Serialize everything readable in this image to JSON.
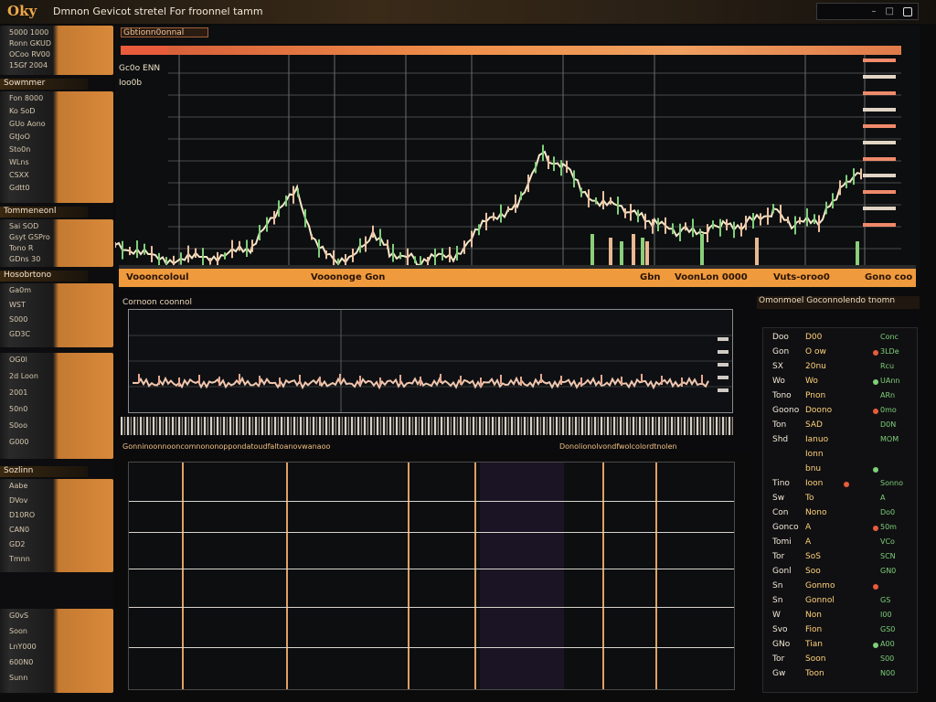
{
  "app": {
    "logo": "Oky",
    "title": "Dmnon Gevicot stretel  For froonnel tamm"
  },
  "window_controls": {
    "minimize": "–",
    "maximize": "□",
    "close": "×"
  },
  "sidebar": {
    "sections": [
      {
        "header": "",
        "rows": [
          "5000  1000",
          "Ronn  GKUD",
          "OCoo  RV00",
          "15Gf  2004"
        ]
      },
      {
        "header": "Sowmmer",
        "rows": [
          "Fon  8000",
          "Ko  SoD",
          "GUo  Aono",
          "GtJoO",
          "Sto0n",
          "WLns",
          "CSXX",
          "Gdtt0"
        ]
      },
      {
        "header": "Tommeneonl",
        "rows": [
          "Sai  SOD",
          "Gsyt  GSPro",
          "Tono  R",
          "GDns  30"
        ]
      },
      {
        "header": "Hosobrtono",
        "rows": [
          "Ga0m",
          "WST",
          "S000",
          "GD3C"
        ]
      },
      {
        "header": "",
        "rows": [
          "OG0l",
          "2d  Loon",
          "2001",
          "50n0",
          "S0oo",
          "G000"
        ]
      },
      {
        "header": "Sozlinn",
        "rows": [
          "Aabe",
          "DVov",
          "D10RO",
          "CAN0",
          "GD2",
          "Tmnn"
        ]
      },
      {
        "header": "",
        "rows": [
          "G0vS",
          "Soon",
          "LnY000",
          "600N0",
          "Sunn"
        ]
      }
    ]
  },
  "main_chart": {
    "top_label": "Gbtionn0onnal",
    "sub1": "Gc0o ENN",
    "sub2": "Ioo0b",
    "axis_labels": [
      "Voooncoloul",
      "Vooonoge Gon",
      "Gbn",
      "VoonLon 0000",
      "Vuts-oroo0",
      "Gono coo"
    ]
  },
  "mid_panel": {
    "title": "Cornoon coonnol",
    "footer_left": "Gonninoonnooncomnononoppondatoudfaltoanovwanaoo",
    "footer_right": "Donolionolvondfwolcolordtnolen"
  },
  "right_panel": {
    "title": "Omonmoel Goconnolendo tnomn",
    "rows": [
      {
        "c1": "Doo",
        "c2": "D00",
        "c3": "Conc"
      },
      {
        "c1": "Gon",
        "c2": "O ow",
        "c3": "3LDe"
      },
      {
        "c1": "SX",
        "c2": "20nu",
        "c3": "Rcu"
      },
      {
        "c1": "Wo",
        "c2": "Wo",
        "c3": "UAnn"
      },
      {
        "c1": "Tono",
        "c2": "Pnon",
        "c3": "ARn"
      },
      {
        "c1": "Goono",
        "c2": "Doono",
        "c3": "0mo"
      },
      {
        "c1": "Ton",
        "c2": "SAD",
        "c3": "D0N"
      },
      {
        "c1": "Shd",
        "c2": "Ianuo",
        "c3": "MOM"
      },
      {
        "c1": "",
        "c2": "Ionn",
        "c3": ""
      },
      {
        "c1": "",
        "c2": "bnu",
        "c3": ""
      },
      {
        "c1": "Tino",
        "c2": "Ioon",
        "c3": "Sonno"
      },
      {
        "c1": "Sw",
        "c2": "To",
        "c3": "A"
      },
      {
        "c1": "Con",
        "c2": "Nono",
        "c3": "Do0"
      },
      {
        "c1": "Gonco",
        "c2": "A",
        "c3": "50m"
      },
      {
        "c1": "Tomi",
        "c2": "A",
        "c3": "VCo"
      },
      {
        "c1": "Tor",
        "c2": "SoS",
        "c3": "SCN"
      },
      {
        "c1": "Gonl",
        "c2": "Soo",
        "c3": "GN0"
      },
      {
        "c1": "Sn",
        "c2": "Gonmo",
        "c3": ""
      },
      {
        "c1": "Sn",
        "c2": "Gonnol",
        "c3": "GS"
      },
      {
        "c1": "W",
        "c2": "Non",
        "c3": "I00"
      },
      {
        "c1": "Svo",
        "c2": "Fion",
        "c3": "GS0"
      },
      {
        "c1": "GNo",
        "c2": "Tian",
        "c3": "A00"
      },
      {
        "c1": "Tor",
        "c2": "Soon",
        "c3": "S00"
      },
      {
        "c1": "Gw",
        "c2": "Toon",
        "c3": "N00"
      }
    ]
  },
  "colors": {
    "accent_orange": "#ef9a3c",
    "up_green": "#7ecf7a",
    "down_red": "#e85c3c",
    "price_line": "#f6e8c8"
  }
}
